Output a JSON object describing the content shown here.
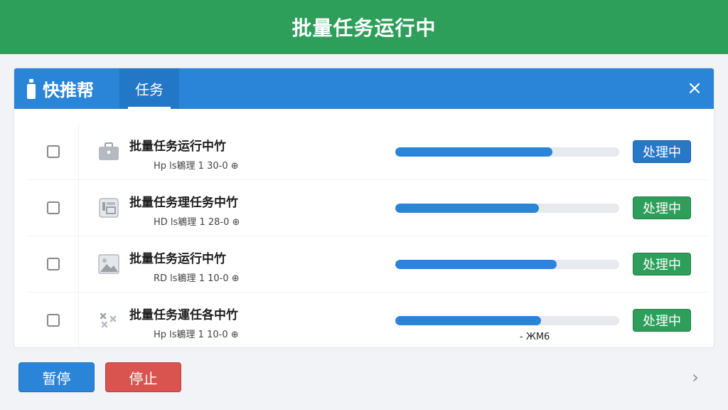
{
  "banner": {
    "title": "批量任务运行中",
    "color": "#2e9e5b"
  },
  "panel": {
    "brand": "快推帮",
    "tab": "任务",
    "close_symbol": "×",
    "accent": "#2a84d8"
  },
  "tasks": [
    {
      "title": "批量任务运行中竹",
      "subtitle": "Hp ls鵴理 1 30-0 ⊕",
      "icon": "briefcase-icon",
      "progress": 0.7,
      "status": "处理中",
      "status_color": "#2778c9"
    },
    {
      "title": "批量任务理任务中竹",
      "subtitle": "HD ls鵴理 1 28-0 ⊕",
      "icon": "document-icon",
      "progress": 0.64,
      "status": "处理中",
      "status_color": "#2e9e5b"
    },
    {
      "title": "批量任务运行中竹",
      "subtitle": "RD ls鵴理 1 10-0 ⊕",
      "icon": "image-icon",
      "progress": 0.72,
      "status": "处理中",
      "status_color": "#2e9e5b"
    },
    {
      "title": "批量任务運任各中竹",
      "subtitle": "Hp ls鵴理 1 10-0 ⊕",
      "icon": "puzzle-icon",
      "progress": 0.65,
      "status": "处理中",
      "status_color": "#2e9e5b"
    }
  ],
  "size_note": "- ЖМ6",
  "footer": {
    "pause_label": "暂停",
    "stop_label": "停止",
    "next_symbol": "›"
  }
}
